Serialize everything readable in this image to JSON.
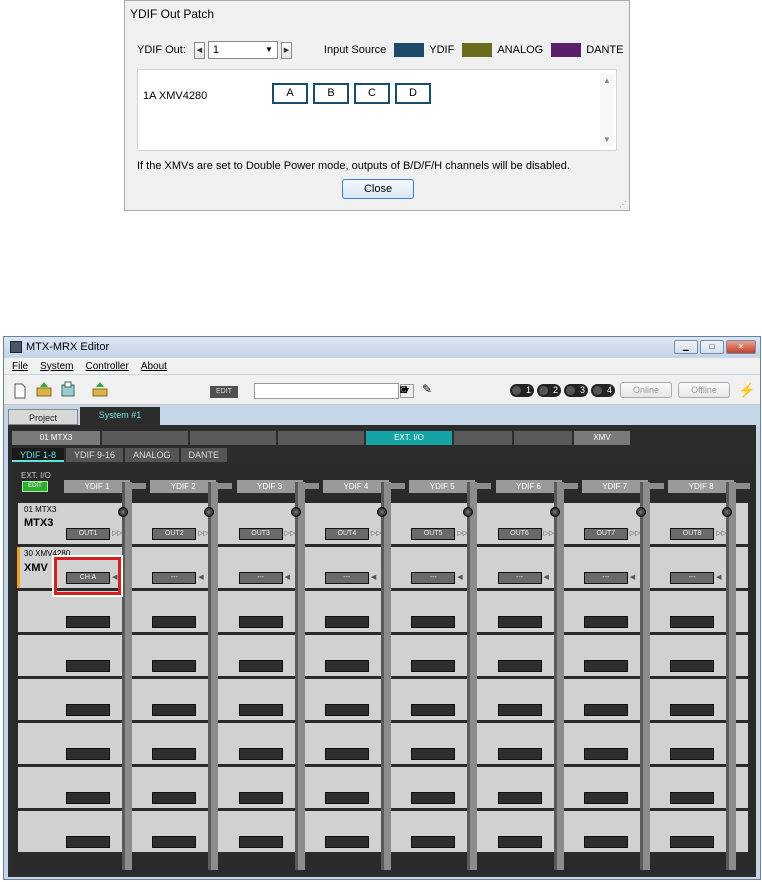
{
  "dialog": {
    "title": "YDIF Out Patch",
    "ydif_out_label": "YDIF Out:",
    "ydif_out_value": "1",
    "input_source_label": "Input Source",
    "legend": [
      {
        "label": "YDIF",
        "color": "#1b4a6b"
      },
      {
        "label": "ANALOG",
        "color": "#6b6b1e"
      },
      {
        "label": "DANTE",
        "color": "#5a1e6b"
      }
    ],
    "device_name": "1A XMV4280",
    "slots": [
      "A",
      "B",
      "C",
      "D"
    ],
    "note": "If the XMVs are set to Double Power mode, outputs of  B/D/F/H channels will be disabled.",
    "close_label": "Close"
  },
  "app": {
    "title": "MTX-MRX Editor",
    "menu": [
      "File",
      "System",
      "Controller",
      "About"
    ],
    "toolbar": {
      "edit_label": "EDIT",
      "unit_numbers": [
        "1",
        "2",
        "3",
        "4"
      ],
      "online_label": "Online",
      "offline_label": "Offline"
    },
    "project_tabs": [
      "Project",
      "System #1"
    ],
    "device_tabs": [
      "01 MTX3",
      "",
      "",
      "",
      "EXT. I/O",
      "",
      "",
      "XMV"
    ],
    "type_tabs": [
      "YDIF 1-8",
      "YDIF 9-16",
      "ANALOG",
      "DANTE"
    ],
    "ext_io_label": "EXT. I/O",
    "ext_edit_label": "EDIT",
    "columns": [
      "YDIF 1",
      "YDIF 2",
      "YDIF 3",
      "YDIF 4",
      "YDIF 5",
      "YDIF 6",
      "YDIF 7",
      "YDIF 8"
    ],
    "rows": [
      {
        "id": "01 MTX3",
        "model": "MTX3",
        "cells": [
          "OUT1",
          "OUT2",
          "OUT3",
          "OUT4",
          "OUT5",
          "OUT6",
          "OUT7",
          "OUT8"
        ]
      },
      {
        "id": "30 XMV4280",
        "model": "XMV",
        "cells": [
          "CH A",
          "---",
          "---",
          "---",
          "---",
          "---",
          "---",
          "---"
        ]
      }
    ]
  }
}
